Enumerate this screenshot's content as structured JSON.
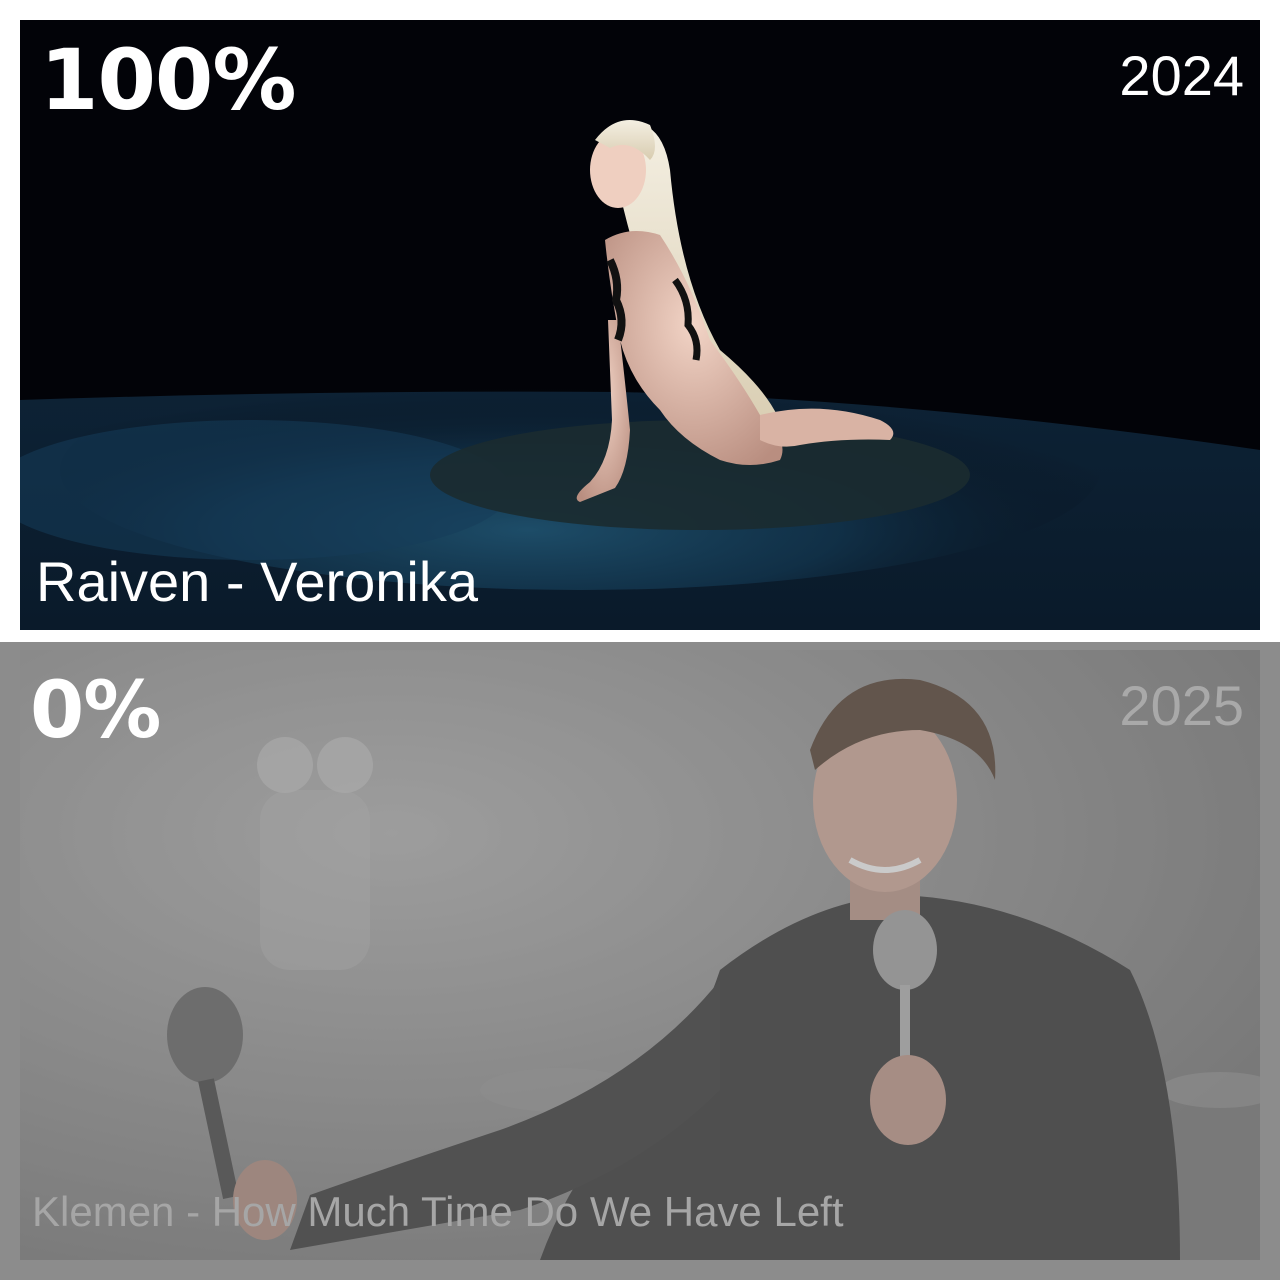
{
  "top_panel": {
    "percentage": "100%",
    "year": "2024",
    "caption": "Raiven - Veronika"
  },
  "bottom_panel": {
    "percentage": "0%",
    "year": "2025",
    "caption": "Klemen - How Much Time Do We Have Left"
  }
}
